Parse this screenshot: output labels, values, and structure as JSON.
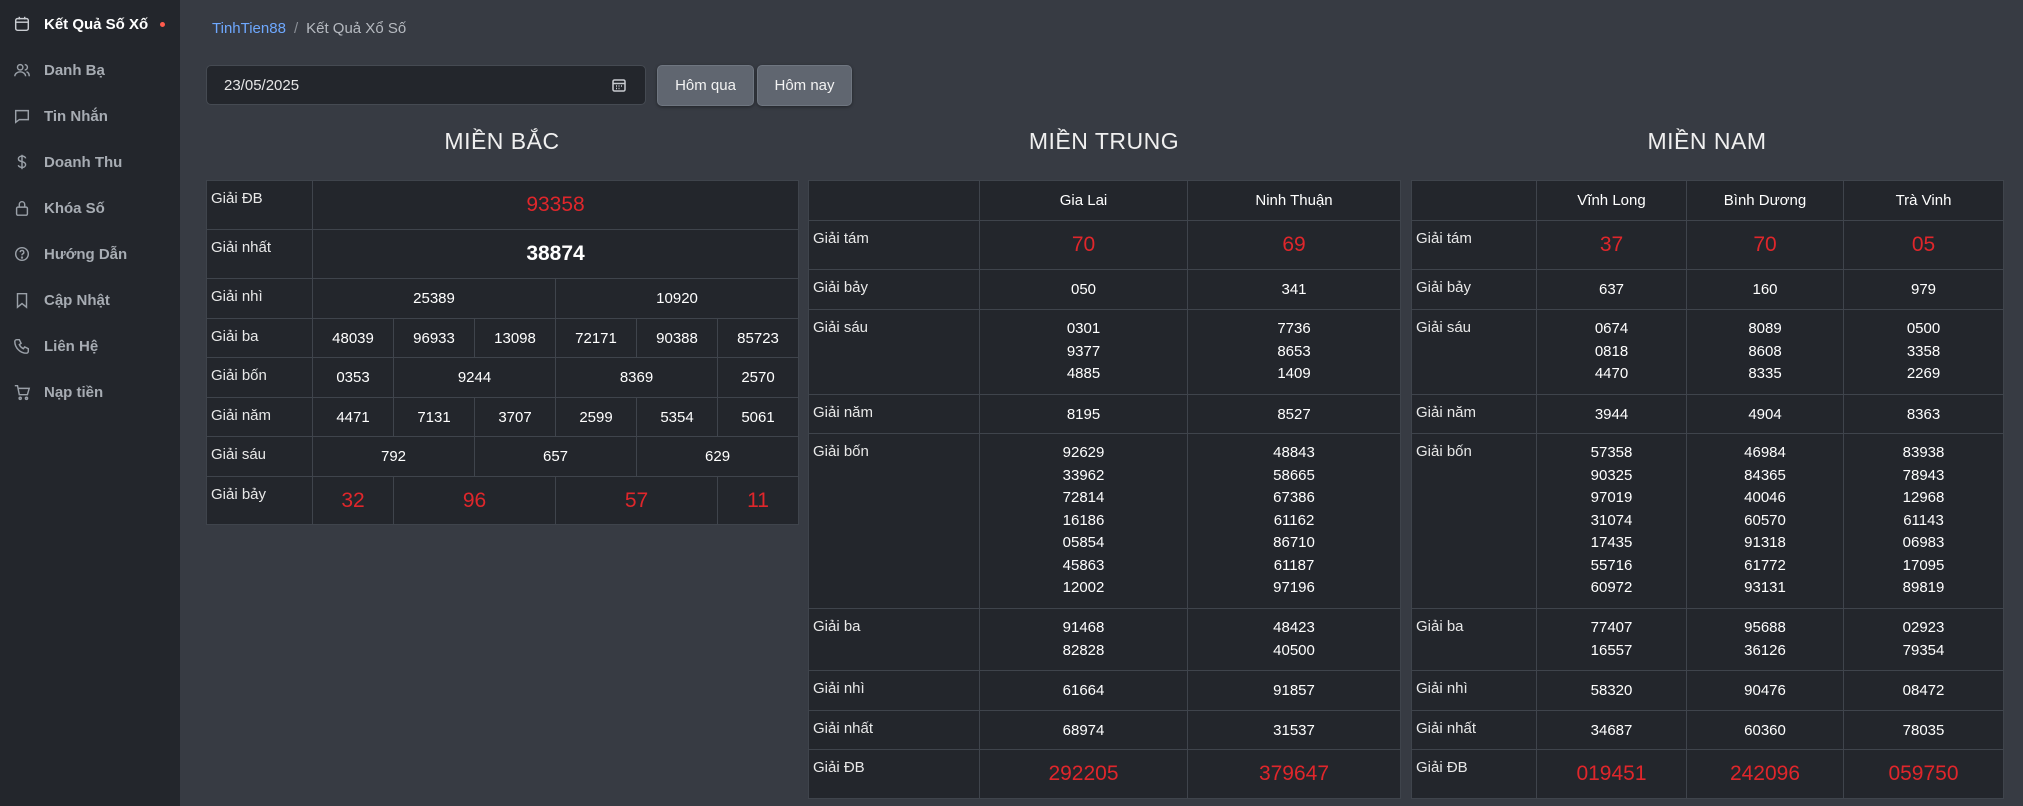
{
  "sidebar": {
    "items": [
      {
        "label": "Kết Quả Số Xố",
        "icon": "calendar-icon"
      },
      {
        "label": "Danh Bạ",
        "icon": "users-icon"
      },
      {
        "label": "Tin Nhắn",
        "icon": "message-icon"
      },
      {
        "label": "Doanh Thu",
        "icon": "dollar-icon"
      },
      {
        "label": "Khóa Số",
        "icon": "lock-icon"
      },
      {
        "label": "Hướng Dẫn",
        "icon": "help-icon"
      },
      {
        "label": "Cập Nhật",
        "icon": "bookmark-icon"
      },
      {
        "label": "Liên Hệ",
        "icon": "phone-icon"
      },
      {
        "label": "Nạp tiền",
        "icon": "cart-icon"
      }
    ]
  },
  "breadcrumb": {
    "home": "TinhTien88",
    "separator": "/",
    "current": "Kết Quả Xổ Số"
  },
  "date_filter": {
    "value": "23/05/2025",
    "yesterday_label": "Hôm qua",
    "today_label": "Hôm nay"
  },
  "colors": {
    "accent_red": "#e0262b",
    "link_blue": "#6ea8fe"
  },
  "mien_bac": {
    "title": "MIỀN BẮC",
    "rows": [
      {
        "label": "Giải ĐB",
        "values": [
          "93358"
        ]
      },
      {
        "label": "Giải nhất",
        "values": [
          "38874"
        ]
      },
      {
        "label": "Giải nhì",
        "values": [
          "25389",
          "10920"
        ]
      },
      {
        "label": "Giải ba",
        "values": [
          "48039",
          "96933",
          "13098",
          "72171",
          "90388",
          "85723"
        ]
      },
      {
        "label": "Giải bốn",
        "values": [
          "0353",
          "9244",
          "8369",
          "2570"
        ]
      },
      {
        "label": "Giải năm",
        "values": [
          "4471",
          "7131",
          "3707",
          "2599",
          "5354",
          "5061"
        ]
      },
      {
        "label": "Giải sáu",
        "values": [
          "792",
          "657",
          "629"
        ]
      },
      {
        "label": "Giải bảy",
        "values": [
          "32",
          "96",
          "57",
          "11"
        ]
      }
    ]
  },
  "mien_trung": {
    "title": "MIỀN TRUNG",
    "provinces": [
      "Gia Lai",
      "Ninh Thuận"
    ],
    "rows": [
      {
        "label": "Giải tám",
        "values": [
          [
            "70"
          ],
          [
            "69"
          ]
        ]
      },
      {
        "label": "Giải bảy",
        "values": [
          [
            "050"
          ],
          [
            "341"
          ]
        ]
      },
      {
        "label": "Giải sáu",
        "values": [
          [
            "0301",
            "9377",
            "4885"
          ],
          [
            "7736",
            "8653",
            "1409"
          ]
        ]
      },
      {
        "label": "Giải năm",
        "values": [
          [
            "8195"
          ],
          [
            "8527"
          ]
        ]
      },
      {
        "label": "Giải bốn",
        "values": [
          [
            "92629",
            "33962",
            "72814",
            "16186",
            "05854",
            "45863",
            "12002"
          ],
          [
            "48843",
            "58665",
            "67386",
            "61162",
            "86710",
            "61187",
            "97196"
          ]
        ]
      },
      {
        "label": "Giải ba",
        "values": [
          [
            "91468",
            "82828"
          ],
          [
            "48423",
            "40500"
          ]
        ]
      },
      {
        "label": "Giải nhì",
        "values": [
          [
            "61664"
          ],
          [
            "91857"
          ]
        ]
      },
      {
        "label": "Giải nhất",
        "values": [
          [
            "68974"
          ],
          [
            "31537"
          ]
        ]
      },
      {
        "label": "Giải ĐB",
        "values": [
          [
            "292205"
          ],
          [
            "379647"
          ]
        ]
      }
    ]
  },
  "mien_nam": {
    "title": "MIỀN NAM",
    "provinces": [
      "Vĩnh Long",
      "Bình Dương",
      "Trà Vinh"
    ],
    "rows": [
      {
        "label": "Giải tám",
        "values": [
          [
            "37"
          ],
          [
            "70"
          ],
          [
            "05"
          ]
        ]
      },
      {
        "label": "Giải bảy",
        "values": [
          [
            "637"
          ],
          [
            "160"
          ],
          [
            "979"
          ]
        ]
      },
      {
        "label": "Giải sáu",
        "values": [
          [
            "0674",
            "0818",
            "4470"
          ],
          [
            "8089",
            "8608",
            "8335"
          ],
          [
            "0500",
            "3358",
            "2269"
          ]
        ]
      },
      {
        "label": "Giải năm",
        "values": [
          [
            "3944"
          ],
          [
            "4904"
          ],
          [
            "8363"
          ]
        ]
      },
      {
        "label": "Giải bốn",
        "values": [
          [
            "57358",
            "90325",
            "97019",
            "31074",
            "17435",
            "55716",
            "60972"
          ],
          [
            "46984",
            "84365",
            "40046",
            "60570",
            "91318",
            "61772",
            "93131"
          ],
          [
            "83938",
            "78943",
            "12968",
            "61143",
            "06983",
            "17095",
            "89819"
          ]
        ]
      },
      {
        "label": "Giải ba",
        "values": [
          [
            "77407",
            "16557"
          ],
          [
            "95688",
            "36126"
          ],
          [
            "02923",
            "79354"
          ]
        ]
      },
      {
        "label": "Giải nhì",
        "values": [
          [
            "58320"
          ],
          [
            "90476"
          ],
          [
            "08472"
          ]
        ]
      },
      {
        "label": "Giải nhất",
        "values": [
          [
            "34687"
          ],
          [
            "60360"
          ],
          [
            "78035"
          ]
        ]
      },
      {
        "label": "Giải ĐB",
        "values": [
          [
            "019451"
          ],
          [
            "242096"
          ],
          [
            "059750"
          ]
        ]
      }
    ]
  }
}
